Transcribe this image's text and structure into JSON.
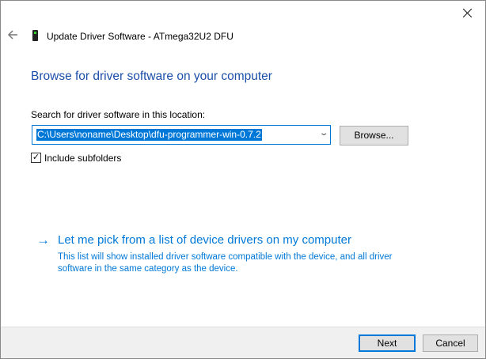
{
  "header": {
    "title": "Update Driver Software - ATmega32U2 DFU"
  },
  "main": {
    "heading": "Browse for driver software on your computer",
    "location_label": "Search for driver software in this location:",
    "location_value": "C:\\Users\\noname\\Desktop\\dfu-programmer-win-0.7.2",
    "browse_label": "Browse...",
    "include_subfolders_label": "Include subfolders",
    "include_subfolders_checked": true,
    "pick_link": "Let me pick from a list of device drivers on my computer",
    "pick_description": "This list will show installed driver software compatible with the device, and all driver software in the same category as the device."
  },
  "footer": {
    "next_label": "Next",
    "cancel_label": "Cancel"
  },
  "colors": {
    "accent": "#0078d7",
    "heading": "#1c4fa8"
  }
}
